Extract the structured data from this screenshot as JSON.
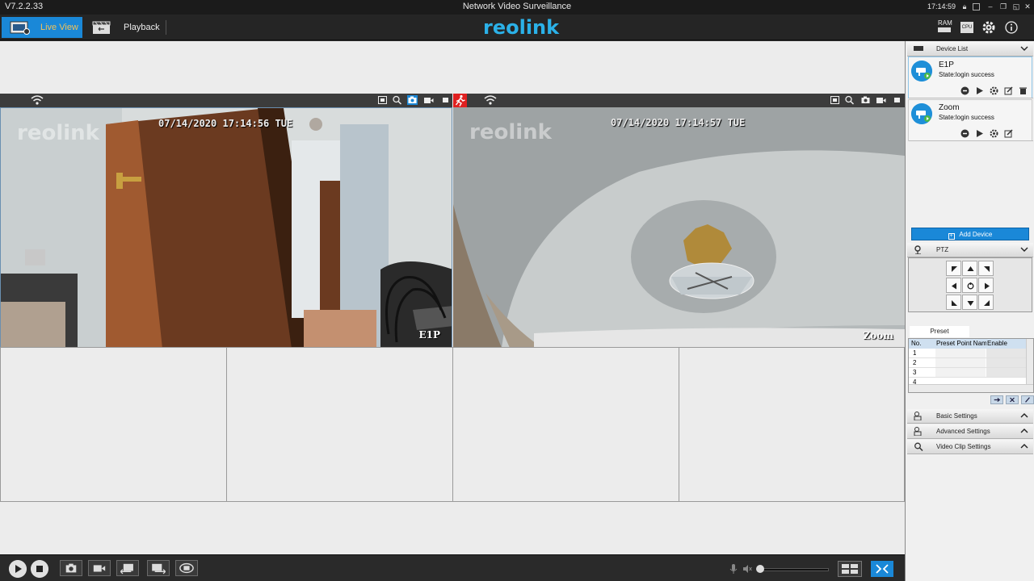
{
  "app": {
    "version": "V7.2.2.33",
    "title": "Network Video Surveillance",
    "clock": "17:14:59",
    "logo": "reolink"
  },
  "nav": {
    "live_label": "Live View",
    "playback_label": "Playback",
    "ram_label": "RAM",
    "cpu_label": "CPU"
  },
  "videos": [
    {
      "timestamp": "07/14/2020 17:14:56 TUE",
      "brand": "reolink",
      "name": "E1P"
    },
    {
      "timestamp": "07/14/2020 17:14:57 TUE",
      "brand": "reolink",
      "name": "Zoom"
    }
  ],
  "panel": {
    "device_list": "Device List",
    "devices": [
      {
        "name": "E1P",
        "state": "State:login success"
      },
      {
        "name": "Zoom",
        "state": "State:login success"
      }
    ],
    "add_device": "Add Device",
    "ptz": "PTZ",
    "preset_tab": "Preset",
    "preset_headers": [
      "No.",
      "Preset Point Nam",
      "Enable"
    ],
    "preset_rows": [
      "1",
      "2",
      "3",
      "4"
    ],
    "basic_settings": "Basic Settings",
    "advanced_settings": "Advanced Settings",
    "video_clip_settings": "Video Clip Settings"
  },
  "colors": {
    "accent": "#1a88d8",
    "logo": "#2bb1e8",
    "motion_alert": "#e02020"
  }
}
